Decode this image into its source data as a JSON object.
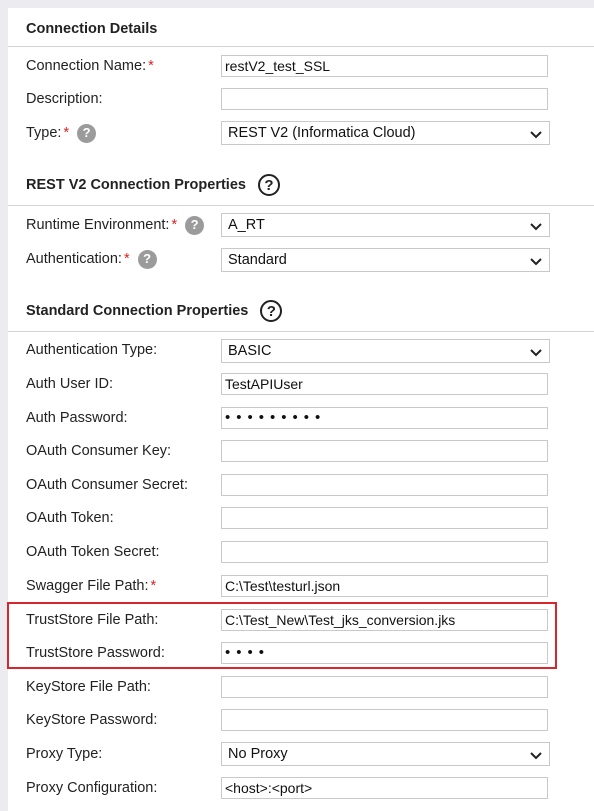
{
  "sections": {
    "connection_details": "Connection Details",
    "rest_v2": "REST V2 Connection Properties",
    "standard": "Standard Connection Properties"
  },
  "help_glyph": "?",
  "required_mark": "*",
  "fields": {
    "connection_name": {
      "label": "Connection Name:",
      "value": "restV2_test_SSL"
    },
    "description": {
      "label": "Description:",
      "value": ""
    },
    "type": {
      "label": "Type:",
      "value": "REST V2 (Informatica Cloud)"
    },
    "runtime_environment": {
      "label": "Runtime Environment:",
      "value": "A_RT"
    },
    "authentication": {
      "label": "Authentication:",
      "value": "Standard"
    },
    "authentication_type": {
      "label": "Authentication Type:",
      "value": "BASIC"
    },
    "auth_user_id": {
      "label": "Auth User ID:",
      "value": "TestAPIUser"
    },
    "auth_password": {
      "label": "Auth Password:",
      "value": "•••••••••"
    },
    "oauth_consumer_key": {
      "label": "OAuth Consumer Key:",
      "value": ""
    },
    "oauth_consumer_secret": {
      "label": "OAuth Consumer Secret:",
      "value": ""
    },
    "oauth_token": {
      "label": "OAuth Token:",
      "value": ""
    },
    "oauth_token_secret": {
      "label": "OAuth Token Secret:",
      "value": ""
    },
    "swagger_file_path": {
      "label": "Swagger File Path:",
      "value": "C:\\Test\\testurl.json"
    },
    "truststore_file_path": {
      "label": "TrustStore File Path:",
      "value": "C:\\Test_New\\Test_jks_conversion.jks"
    },
    "truststore_password": {
      "label": "TrustStore Password:",
      "value": "••••"
    },
    "keystore_file_path": {
      "label": "KeyStore File Path:",
      "value": ""
    },
    "keystore_password": {
      "label": "KeyStore Password:",
      "value": ""
    },
    "proxy_type": {
      "label": "Proxy Type:",
      "value": "No Proxy"
    },
    "proxy_configuration": {
      "label": "Proxy Configuration:",
      "value": "<host>:<port>"
    }
  },
  "colors": {
    "highlight_border": "#d9262e",
    "required": "#dd2222",
    "help_icon_gray": "#9b9b9b"
  }
}
